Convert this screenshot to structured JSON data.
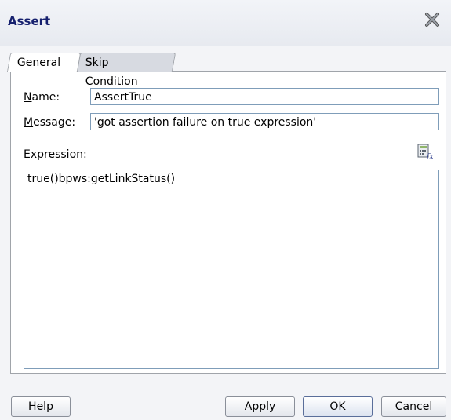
{
  "dialog": {
    "title": "Assert"
  },
  "tabs": [
    {
      "label": "General",
      "active": true
    },
    {
      "label": "Skip Condition",
      "active": false
    }
  ],
  "form": {
    "name_label_mnemonic": "N",
    "name_label_rest": "ame:",
    "name_value": "AssertTrue",
    "message_label_mnemonic": "M",
    "message_label_rest": "essage:",
    "message_value": "'got assertion failure on true expression'",
    "expression_label_mnemonic": "E",
    "expression_label_rest": "xpression:",
    "expression_value": "true()bpws:getLinkStatus()"
  },
  "buttons": {
    "help_mnemonic": "H",
    "help_rest": "elp",
    "apply_mnemonic": "A",
    "apply_rest": "pply",
    "ok_label": "OK",
    "cancel_label": "Cancel"
  },
  "icons": {
    "close": "close-icon",
    "expression_builder": "expression-builder-icon"
  }
}
